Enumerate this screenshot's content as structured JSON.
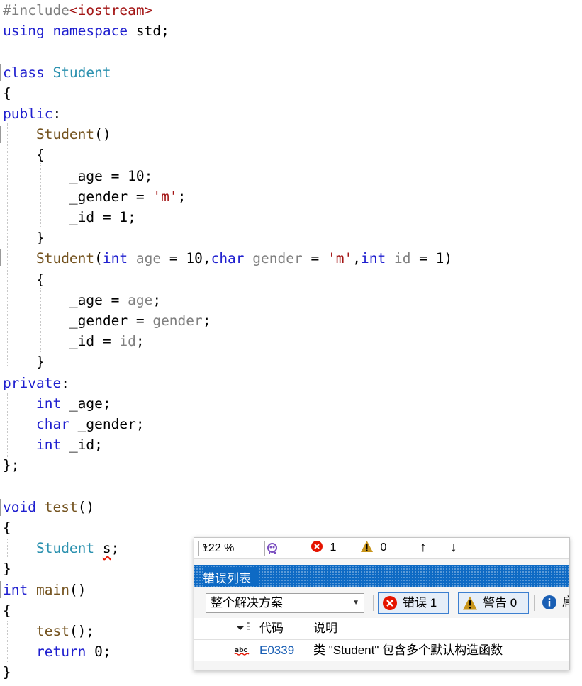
{
  "code_lines": [
    "#include<iostream>",
    "using namespace std;",
    "",
    "class Student",
    "{",
    "public:",
    "    Student()",
    "    {",
    "        _age = 10;",
    "        _gender = 'm';",
    "        _id = 1;",
    "    }",
    "    Student(int age = 10,char gender = 'm',int id = 1)",
    "    {",
    "        _age = age;",
    "        _gender = gender;",
    "        _id = id;",
    "    }",
    "private:",
    "    int _age;",
    "    char _gender;",
    "    int _id;",
    "};",
    "",
    "void test()",
    "{",
    "    Student s;",
    "}",
    "int main()",
    "{",
    "    test();",
    "    return 0;",
    "}"
  ],
  "status_bar": {
    "zoom": "122 %",
    "error_count": "1",
    "warning_count": "0",
    "up_arrow": "↑",
    "down_arrow": "↓"
  },
  "error_list": {
    "title": "错误列表",
    "scope": "整个解决方案",
    "errors_button": "错误 1",
    "warnings_button": "警告 0",
    "messages_button_partial": "肩",
    "columns": {
      "code": "代码",
      "description": "说明"
    },
    "rows": [
      {
        "icon": "abc",
        "code": "E0339",
        "description": "类 \"Student\" 包含多个默认构造函数"
      }
    ]
  },
  "colors": {
    "keyword": "#1f1fcf",
    "type": "#2b91af",
    "function": "#74531f",
    "string": "#a31515",
    "parameter": "#808080",
    "titlebar": "#0e6ac4",
    "error_red": "#e51400",
    "warning_amber": "#c8951c",
    "info_blue": "#1a5fb4"
  }
}
